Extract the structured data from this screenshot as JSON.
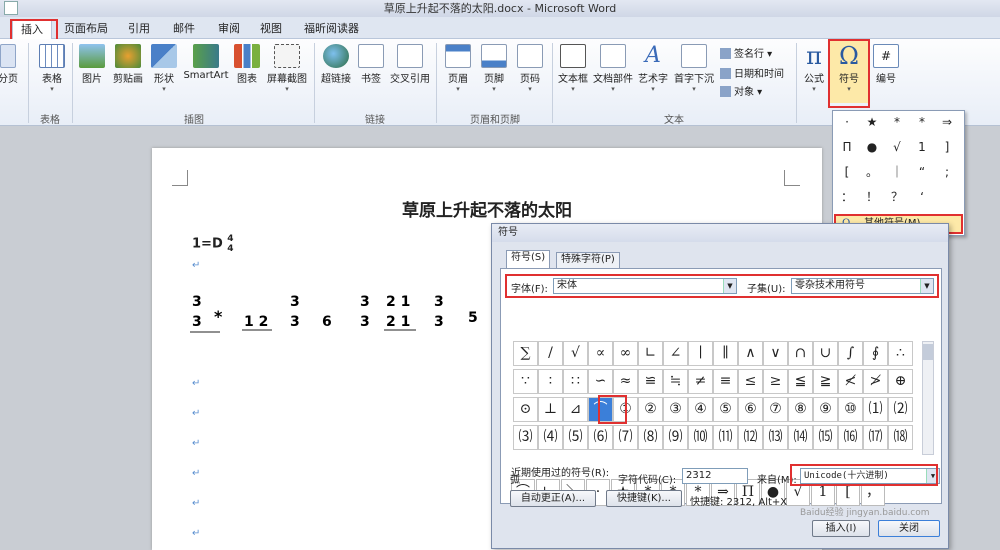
{
  "window": {
    "title": "草原上升起不落的太阳.docx - Microsoft Word"
  },
  "tabs": [
    "插入",
    "页面布局",
    "引用",
    "邮件",
    "审阅",
    "视图",
    "福昕阅读器"
  ],
  "ribbon": {
    "pages_label": "分页",
    "table": "表格",
    "picture": "图片",
    "clipart": "剪贴画",
    "shapes": "形状",
    "smartart": "SmartArt",
    "chart": "图表",
    "screenshot": "屏幕截图",
    "hyperlink": "超链接",
    "bookmark": "书签",
    "crossref": "交叉引用",
    "header": "页眉",
    "footer": "页脚",
    "pagenum": "页码",
    "textbox": "文本框",
    "quickparts": "文档部件",
    "wordart": "艺术字",
    "dropcap": "首字下沉",
    "signature": "签名行",
    "datetime": "日期和时间",
    "object": "对象",
    "equation": "公式",
    "symbol": "符号",
    "number": "编号",
    "groups": {
      "table": "表格",
      "illustrations": "插图",
      "links": "链接",
      "headerfooter": "页眉和页脚",
      "text": "文本"
    }
  },
  "document": {
    "title": "草原上升起不落的太阳",
    "key": "1=D",
    "time_num": "4",
    "time_den": "4"
  },
  "symbol_dropdown": {
    "symbols": [
      "·",
      "★",
      "*",
      "*",
      "⇒",
      "Π",
      "●",
      "√",
      "1",
      "]",
      "[",
      "。",
      "｜",
      "“",
      ";",
      "：",
      "！",
      "？",
      "‘"
    ],
    "more": "其他符号(M)..."
  },
  "dialog": {
    "title": "符号",
    "tab_symbols": "符号(S)",
    "tab_special": "特殊字符(P)",
    "font_label": "字体(F):",
    "font_value": "宋体",
    "subset_label": "子集(U):",
    "subset_value": "零杂技术用符号",
    "grid": [
      "∑",
      "/",
      "√",
      "∝",
      "∞",
      "∟",
      "∠",
      "∣",
      "∥",
      "∧",
      "∨",
      "∩",
      "∪",
      "∫",
      "∮",
      "∴",
      "∵",
      "∶",
      "∷",
      "∽",
      "≈",
      "≌",
      "≒",
      "≠",
      "≡",
      "≤",
      "≥",
      "≦",
      "≧",
      "≮",
      "≯",
      "⊕",
      "⊙",
      "⊥",
      "⊿",
      "⌒",
      "①",
      "②",
      "③",
      "④",
      "⑤",
      "⑥",
      "⑦",
      "⑧",
      "⑨",
      "⑩",
      "⑴",
      "⑵",
      "⑶",
      "⑷",
      "⑸",
      "⑹",
      "⑺",
      "⑻",
      "⑼",
      "⑽",
      "⑾",
      "⑿",
      "⒀",
      "⒁",
      "⒂",
      "⒃",
      "⒄",
      "⒅"
    ],
    "recent_label": "近期使用过的符号(R):",
    "recent": [
      "⌒",
      "∟",
      "＼",
      "·",
      "★",
      "*",
      "*",
      "*",
      "⇒",
      "Π",
      "●",
      "√",
      "1",
      "[",
      "，"
    ],
    "char_name": "弧",
    "code_label": "字符代码(C):",
    "code_value": "2312",
    "from_label": "来自(M):",
    "from_value": "Unicode(十六进制)",
    "autocorrect": "自动更正(A)...",
    "shortcut_key": "快捷键(K)...",
    "shortcut_text": "快捷键: 2312, Alt+X",
    "insert": "插入(I)",
    "close": "关闭"
  },
  "watermark": "Baidu经验 jingyan.baidu.com"
}
